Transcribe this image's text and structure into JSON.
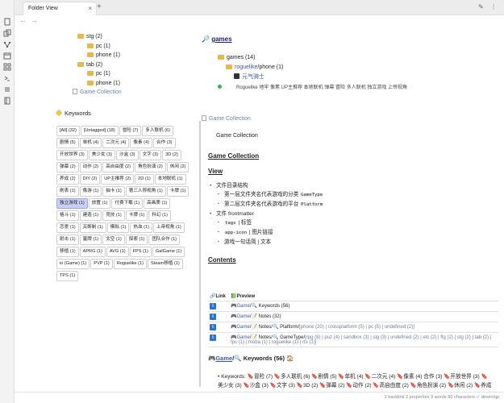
{
  "tab": {
    "title": "Folder View",
    "close": "×",
    "new": "+"
  },
  "nav": {
    "back": "←",
    "forward": "→"
  },
  "tree": {
    "rows": [
      {
        "label": "stg (2)",
        "type": "folder",
        "indent": 0
      },
      {
        "label": "pc (1)",
        "type": "folder",
        "indent": 1
      },
      {
        "label": "phone (1)",
        "type": "folder",
        "indent": 1
      },
      {
        "label": "tab (2)",
        "type": "folder",
        "indent": 0
      },
      {
        "label": "pc (1)",
        "type": "folder",
        "indent": 1
      },
      {
        "label": "phone (1)",
        "type": "folder",
        "indent": 1
      },
      {
        "label": "Game Collection",
        "type": "file",
        "indent": -1
      }
    ]
  },
  "keywords": {
    "title": "Keywords",
    "tags": [
      "[All] (32)",
      "[Untagged] (18)",
      "冒险 (7)",
      "多人联机 (6)",
      "剧情 (5)",
      "单机 (4)",
      "二次元 (4)",
      "像素 (4)",
      "合作 (3)",
      "开放世界 (3)",
      "美少女 (3)",
      "沙盒 (3)",
      "文字 (3)",
      "3D (2)",
      "弹幕 (2)",
      "动作 (2)",
      "高自由度 (2)",
      "角色扮演 (2)",
      "休闲 (2)",
      "养成 (2)",
      "DIY (2)",
      "UP主推荐 (2)",
      "2D (1)",
      "本地联机 (1)",
      "刷表 (1)",
      "像游 (1)",
      "抽卡 (1)",
      "第三人称视角 (1)",
      "卡牌 (1)",
      "独立游戏 (1)",
      "放置 (1)",
      "付费下载 (1)",
      "高画质 (1)",
      "格斗 (1)",
      "建造 (1)",
      "竞技 (1)",
      "卡牌 (1)",
      "科幻 (1)",
      "恋爱 (1)",
      "买断制 (1)",
      "模拟 (1)",
      "热血 (1)",
      "上帝视角 (1)",
      "射击 (1)",
      "塞牌 (1)",
      "太空 (1)",
      "探索 (1)",
      "团队合作 (1)",
      "移植 (1)",
      "APRG (1)",
      "AVG (1)",
      "FPS (1)",
      "GalGame (1)",
      "io (Game) (1)",
      "PVP (1)",
      "Roguelike (1)",
      "Steam移植 (1)",
      "TPS (1)"
    ],
    "active_index": 29
  },
  "games": {
    "title": "games",
    "row1": "games (14)",
    "row2_a": "roguelike",
    "row2_b": "/phone (1)",
    "row3": "元气骑士",
    "row4": "Roguelike 地牢 像素 UP主推荐 本地联机 弹幕 冒险 多人联机 独立游戏 上帝视角"
  },
  "doc": {
    "header": "Game Collection",
    "line": "Game Collection",
    "h1": "Game Collection",
    "view": "View",
    "li1": "文件目录结构",
    "li1a": "第一层文件夹名代表游戏的分类",
    "li1a_code": "GameType",
    "li1b": "第二层文件夹名代表游戏的平台",
    "li1b_code": "Platform",
    "li2": "文件 frontmatter",
    "li2a_code": "tags",
    "li2a": "| 标签",
    "li2b_code": "app-icon",
    "li2b": "| 图片链接",
    "li2c": "游戏一句话简 | 文本",
    "contents": "Contents",
    "th_link": "Link",
    "th_preview": "Preview",
    "rows": [
      {
        "a": "Game",
        "b": "/🔍 Keywords (56)",
        "c": ""
      },
      {
        "a": "Game",
        "b": "/📝 Notes (32)",
        "c": ""
      },
      {
        "a": "Game",
        "b": "/📝 Notes/🔍 Platform/",
        "c": "[phone (20) | crossplatform (5) | pc (5) | undefined (2)]"
      },
      {
        "a": "Game",
        "b": "/📝 Notes/🔍 GameType/",
        "c": "[rpg (8) | puz (4) | sandbox (3) | slg (3) | undefined (2) | etc (2) | ftg (2) | stg (2) | tab (2) | fps (1) | moba (1) | roguelike (1) | rts (1)]"
      }
    ],
    "kw_title_a": "Game",
    "kw_title_b": "/🔍 Keywords (56) 🏠",
    "kw_line": "Keywords: 🔖冒险 (7) 🔖多人联机 (6) 🔖剧情 (5) 🔖单机 (4) 🔖二次元 (4) 🔖像素 (4) 合作 (3) 🔖开放世界 (3) 🔖美少女 (3) 🔖沙盒 (3) 🔖文字 (3) 🔖3D (2) 🔖弹幕 (2) 🔖动作 (2) 🔖高自由度 (2) 🔖角色扮演 (2) 🔖休闲 (2) 🔖养成"
  },
  "status": "1 backlink   2 properties   9 words  80 characters   ✓   dewinlqp",
  "ribbon_icons": [
    "file-icon",
    "copy-icon",
    "graph-icon",
    "calendar-icon",
    "grid-icon",
    "terminal-icon",
    "list-icon",
    "book-icon"
  ]
}
